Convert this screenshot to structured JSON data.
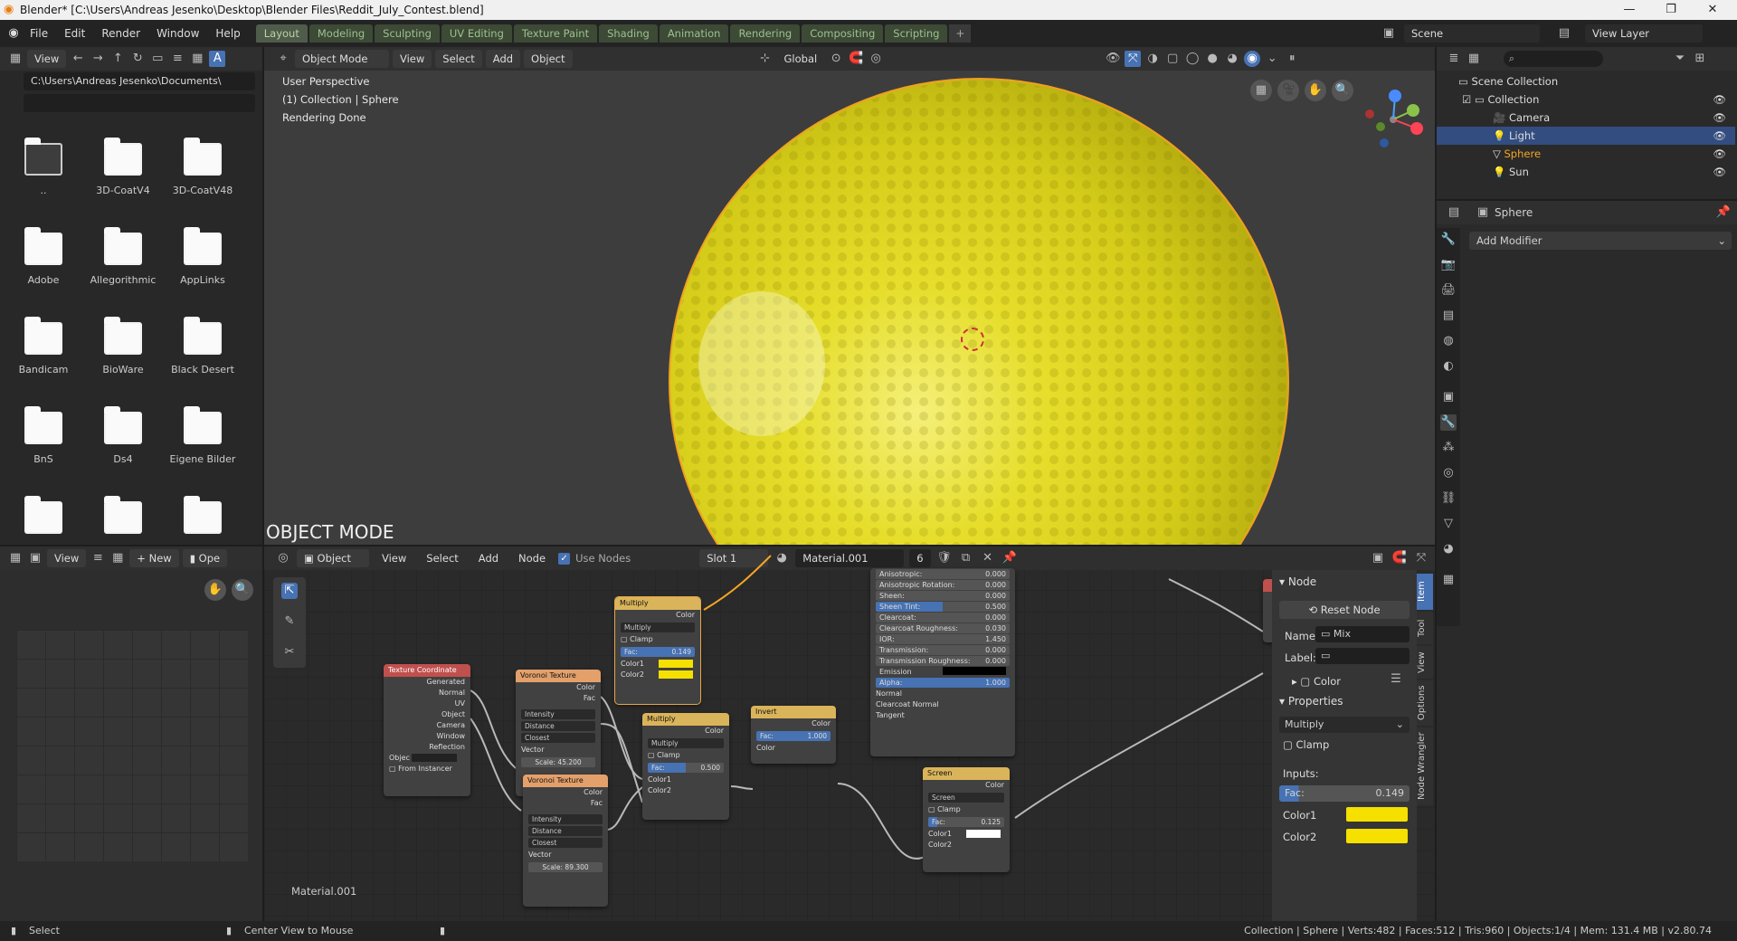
{
  "window": {
    "title": "Blender* [C:\\Users\\Andreas Jesenko\\Desktop\\Blender Files\\Reddit_July_Contest.blend]"
  },
  "menu": [
    "File",
    "Edit",
    "Render",
    "Window",
    "Help"
  ],
  "workspaces": [
    "Layout",
    "Modeling",
    "Sculpting",
    "UV Editing",
    "Texture Paint",
    "Shading",
    "Animation",
    "Rendering",
    "Compositing",
    "Scripting"
  ],
  "scene": {
    "label": "Scene",
    "view_layer": "View Layer"
  },
  "file_browser": {
    "view_label": "View",
    "path": "C:\\Users\\Andreas Jesenko\\Documents\\",
    "items": [
      "..",
      "3D-CoatV4",
      "3D-CoatV48",
      "Adobe",
      "Allegorithmic",
      "AppLinks",
      "Bandicam",
      "BioWare",
      "Black Desert",
      "BnS",
      "Ds4",
      "Eigene Bilder",
      "",
      "",
      ""
    ]
  },
  "viewport": {
    "mode": "Object Mode",
    "menus": [
      "View",
      "Select",
      "Add",
      "Object"
    ],
    "transform": "Global",
    "overlay_lines": [
      "User Perspective",
      "(1) Collection | Sphere",
      "Rendering Done"
    ],
    "mode_banner": "OBJECT MODE"
  },
  "outliner": {
    "root": "Scene Collection",
    "collection": "Collection",
    "items": [
      "Camera",
      "Light",
      "Sphere",
      "Sun"
    ]
  },
  "properties": {
    "object": "Sphere",
    "add_modifier": "Add Modifier"
  },
  "image_editor": {
    "view": "View",
    "new": "New",
    "open": "Ope"
  },
  "node_editor": {
    "type": "Object",
    "menus": [
      "View",
      "Select",
      "Add",
      "Node"
    ],
    "use_nodes": "Use Nodes",
    "slot": "Slot 1",
    "material": "Material.001",
    "users": "6",
    "footer_label": "Material.001",
    "nodes": {
      "texcoord": {
        "title": "Texture Coordinate",
        "outputs": [
          "Generated",
          "Normal",
          "UV",
          "Object",
          "Camera",
          "Window",
          "Reflection"
        ],
        "object_label": "Objec",
        "from_instancer": "From Instancer"
      },
      "voronoi1": {
        "title": "Voronoi Texture",
        "outputs": [
          "Color",
          "Fac"
        ],
        "opts": [
          "Intensity",
          "Distance",
          "Closest"
        ],
        "vector": "Vector",
        "scale_label": "Scale:",
        "scale": "45.200"
      },
      "voronoi2": {
        "title": "Voronoi Texture",
        "outputs": [
          "Color",
          "Fac"
        ],
        "opts": [
          "Intensity",
          "Distance",
          "Closest"
        ],
        "vector": "Vector",
        "scale_label": "Scale:",
        "scale": "89.300"
      },
      "multiply1": {
        "title": "Multiply",
        "out": "Color",
        "op": "Multiply",
        "clamp": "Clamp",
        "fac_label": "Fac:",
        "fac": "0.149",
        "c1": "Color1",
        "c2": "Color2"
      },
      "multiply2": {
        "title": "Multiply",
        "out": "Color",
        "op": "Multiply",
        "clamp": "Clamp",
        "fac_label": "Fac:",
        "fac": "0.500",
        "c1": "Color1",
        "c2": "Color2"
      },
      "invert": {
        "title": "Invert",
        "out": "Color",
        "fac_label": "Fac:",
        "fac": "1.000",
        "in": "Color"
      },
      "screen": {
        "title": "Screen",
        "out": "Color",
        "op": "Screen",
        "clamp": "Clamp",
        "fac_label": "Fac:",
        "fac": "0.125",
        "c1": "Color1",
        "c2": "Color2"
      },
      "bsdf": {
        "rows": [
          {
            "label": "Anisotropic:",
            "value": "0.000"
          },
          {
            "label": "Anisotropic Rotation:",
            "value": "0.000"
          },
          {
            "label": "Sheen:",
            "value": "0.000"
          },
          {
            "label": "Sheen Tint:",
            "value": "0.500"
          },
          {
            "label": "Clearcoat:",
            "value": "0.000"
          },
          {
            "label": "Clearcoat Roughness:",
            "value": "0.030"
          },
          {
            "label": "IOR:",
            "value": "1.450"
          },
          {
            "label": "Transmission:",
            "value": "0.000"
          },
          {
            "label": "Transmission Roughness:",
            "value": "0.000"
          },
          {
            "label": "Emission",
            "value": ""
          },
          {
            "label": "Alpha:",
            "value": "1.000"
          },
          {
            "label": "Normal",
            "value": ""
          },
          {
            "label": "Clearcoat Normal",
            "value": ""
          },
          {
            "label": "Tangent",
            "value": ""
          }
        ]
      }
    }
  },
  "npanel": {
    "node_header": "Node",
    "reset": "Reset Node",
    "name_label": "Name:",
    "name": "Mix",
    "label_label": "Label:",
    "color_label": "Color",
    "properties_header": "Properties",
    "blend": "Multiply",
    "clamp": "Clamp",
    "inputs": "Inputs:",
    "fac_label": "Fac:",
    "fac": "0.149",
    "color1": "Color1",
    "color2": "Color2",
    "tabs": [
      "Item",
      "Tool",
      "View",
      "Options",
      "Node Wrangler"
    ]
  },
  "colors": {
    "accent": "#4772b3",
    "yellow": "#f5e000",
    "orange": "#f5a623",
    "ws_tab": "#3c4a36"
  },
  "status": {
    "left": "Select",
    "mid": "Center View to Mouse",
    "right": "Collection | Sphere | Verts:482 | Faces:512 | Tris:960 | Objects:1/4 | Mem: 131.4 MB | v2.80.74"
  }
}
